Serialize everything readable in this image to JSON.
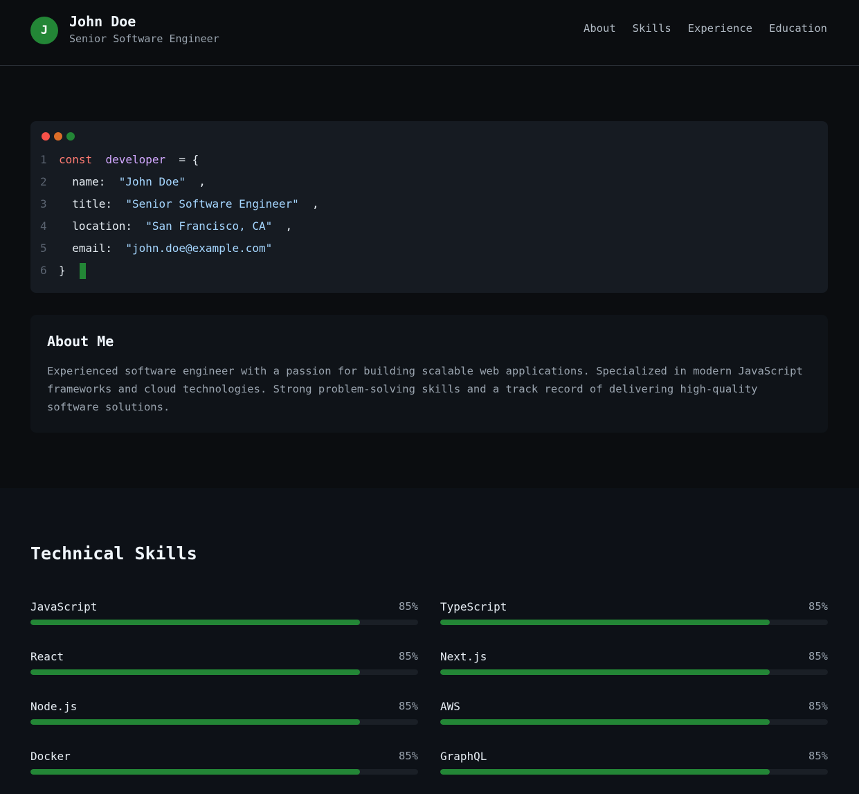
{
  "header": {
    "avatar_letter": "J",
    "name": "John Doe",
    "subtitle": "Senior Software Engineer",
    "nav": [
      "About",
      "Skills",
      "Experience",
      "Education"
    ]
  },
  "code": {
    "line_numbers": [
      "1",
      "2",
      "3",
      "4",
      "5",
      "6"
    ],
    "keyword": "const",
    "variable": "developer",
    "open": " = {",
    "fields": [
      {
        "key": "name:",
        "value": "\"John Doe\"",
        "suffix": ","
      },
      {
        "key": "title:",
        "value": "\"Senior Software Engineer\"",
        "suffix": ","
      },
      {
        "key": "location:",
        "value": "\"San Francisco, CA\"",
        "suffix": ","
      },
      {
        "key": "email:",
        "value": "\"john.doe@example.com\"",
        "suffix": ""
      }
    ],
    "close": "}"
  },
  "about": {
    "title": "About Me",
    "text": "Experienced software engineer with a passion for building scalable web applications. Specialized in modern JavaScript frameworks and cloud technologies. Strong problem-solving skills and a track record of delivering high-quality software solutions."
  },
  "skills": {
    "title": "Technical Skills",
    "items": [
      {
        "name": "JavaScript",
        "percent_label": "85%",
        "level": 0.85
      },
      {
        "name": "TypeScript",
        "percent_label": "85%",
        "level": 0.85
      },
      {
        "name": "React",
        "percent_label": "85%",
        "level": 0.85
      },
      {
        "name": "Next.js",
        "percent_label": "85%",
        "level": 0.85
      },
      {
        "name": "Node.js",
        "percent_label": "85%",
        "level": 0.85
      },
      {
        "name": "AWS",
        "percent_label": "85%",
        "level": 0.85
      },
      {
        "name": "Docker",
        "percent_label": "85%",
        "level": 0.85
      },
      {
        "name": "GraphQL",
        "percent_label": "85%",
        "level": 0.85
      }
    ]
  },
  "colors": {
    "accent": "#238636",
    "background": "#0b0d10",
    "card": "#161b22"
  }
}
